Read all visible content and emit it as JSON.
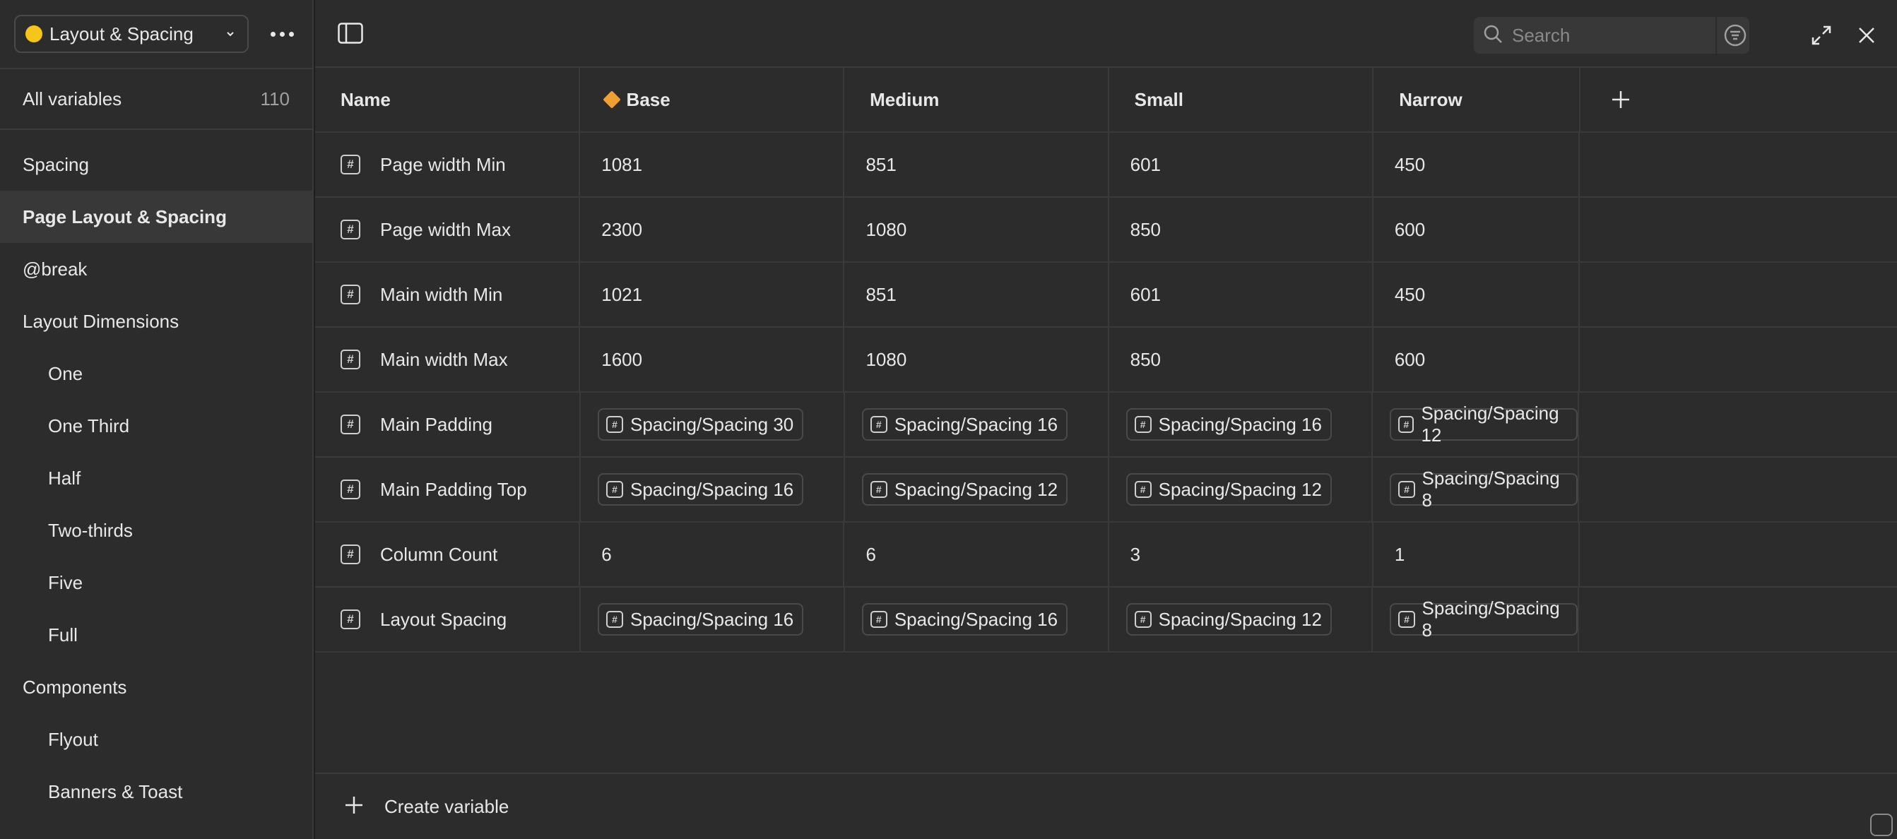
{
  "sidebar": {
    "collection": {
      "name": "Layout & Spacing",
      "dot_color": "#f5c518"
    },
    "all_variables": {
      "label": "All variables",
      "count": "110"
    },
    "items": [
      {
        "label": "Spacing",
        "indent": false,
        "active": false
      },
      {
        "label": "Page Layout & Spacing",
        "indent": false,
        "active": true
      },
      {
        "label": "@break",
        "indent": false,
        "active": false
      },
      {
        "label": "Layout Dimensions",
        "indent": false,
        "active": false
      },
      {
        "label": "One",
        "indent": true,
        "active": false
      },
      {
        "label": "One Third",
        "indent": true,
        "active": false
      },
      {
        "label": "Half",
        "indent": true,
        "active": false
      },
      {
        "label": "Two-thirds",
        "indent": true,
        "active": false
      },
      {
        "label": "Five",
        "indent": true,
        "active": false
      },
      {
        "label": "Full",
        "indent": true,
        "active": false
      },
      {
        "label": "Components",
        "indent": false,
        "active": false
      },
      {
        "label": "Flyout",
        "indent": true,
        "active": false
      },
      {
        "label": "Banners & Toast",
        "indent": true,
        "active": false
      }
    ]
  },
  "toolbar": {
    "search_placeholder": "Search"
  },
  "table": {
    "columns": [
      "Name",
      "Base",
      "Medium",
      "Small",
      "Narrow"
    ],
    "default_mode_color": "#f0a030",
    "rows": [
      {
        "name": "Page width Min",
        "values": [
          {
            "text": "1081"
          },
          {
            "text": "851"
          },
          {
            "text": "601"
          },
          {
            "text": "450"
          }
        ]
      },
      {
        "name": "Page width Max",
        "values": [
          {
            "text": "2300"
          },
          {
            "text": "1080"
          },
          {
            "text": "850"
          },
          {
            "text": "600"
          }
        ]
      },
      {
        "name": "Main width Min",
        "values": [
          {
            "text": "1021"
          },
          {
            "text": "851"
          },
          {
            "text": "601"
          },
          {
            "text": "450"
          }
        ]
      },
      {
        "name": "Main width Max",
        "values": [
          {
            "text": "1600"
          },
          {
            "text": "1080"
          },
          {
            "text": "850"
          },
          {
            "text": "600"
          }
        ]
      },
      {
        "name": "Main Padding",
        "values": [
          {
            "alias": "Spacing/Spacing 30"
          },
          {
            "alias": "Spacing/Spacing 16"
          },
          {
            "alias": "Spacing/Spacing 16"
          },
          {
            "alias": "Spacing/Spacing 12"
          }
        ]
      },
      {
        "name": "Main Padding Top",
        "values": [
          {
            "alias": "Spacing/Spacing 16"
          },
          {
            "alias": "Spacing/Spacing 12"
          },
          {
            "alias": "Spacing/Spacing 12"
          },
          {
            "alias": "Spacing/Spacing 8"
          }
        ]
      },
      {
        "name": "Column Count",
        "values": [
          {
            "text": "6"
          },
          {
            "text": "6"
          },
          {
            "text": "3"
          },
          {
            "text": "1"
          }
        ]
      },
      {
        "name": "Layout Spacing",
        "values": [
          {
            "alias": "Spacing/Spacing 16"
          },
          {
            "alias": "Spacing/Spacing 16"
          },
          {
            "alias": "Spacing/Spacing 12"
          },
          {
            "alias": "Spacing/Spacing 8"
          }
        ]
      }
    ]
  },
  "footer": {
    "create_label": "Create variable"
  }
}
